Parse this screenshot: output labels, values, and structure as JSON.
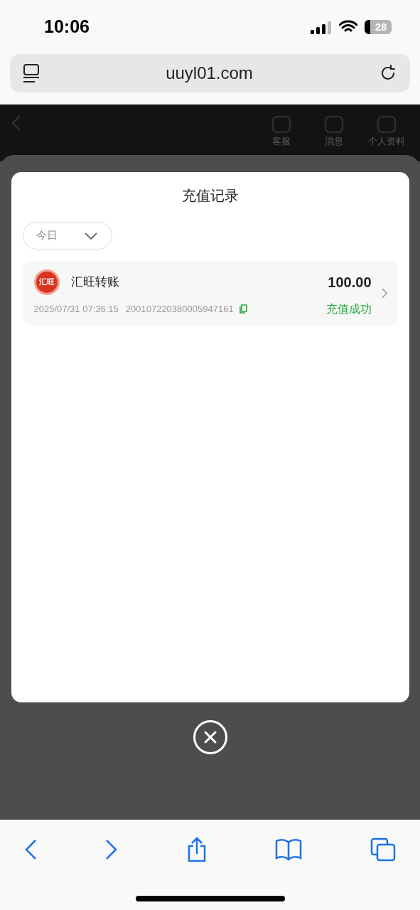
{
  "status_bar": {
    "time": "10:06",
    "battery": "28"
  },
  "address_bar": {
    "url": "uuyl01.com"
  },
  "page_header": {
    "items": [
      {
        "label": "客服"
      },
      {
        "label": "消息"
      },
      {
        "label": "个人资料"
      }
    ]
  },
  "dialog": {
    "title": "充值记录",
    "filter": {
      "value": "今日"
    },
    "records": [
      {
        "logo_text": "汇旺",
        "name": "汇旺转账",
        "amount": "100.00",
        "time": "2025/07/31 07:36:15",
        "order_no": "200107220380005947161",
        "status": "充值成功",
        "kind": "success"
      }
    ]
  }
}
